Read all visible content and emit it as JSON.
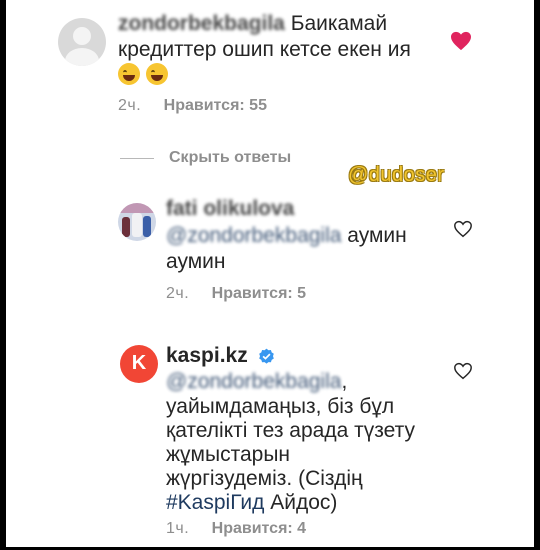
{
  "comment1": {
    "username": "zondorbekbagila",
    "text_line1": "Баикамай",
    "text_line2": "кредиттер ошип кетсе екен ия",
    "emojis": [
      "😂",
      "😂"
    ],
    "time": "2ч.",
    "likes": "Нравится: 55",
    "liked": true,
    "heart_color": "#e0245e"
  },
  "hide_replies": "Скрыть ответы",
  "watermark": "@dudoser",
  "reply1": {
    "username": "fati olikulova",
    "mention": "@zondorbekbagila",
    "text_line1": "аумин",
    "text_line2": "аумин",
    "time": "2ч.",
    "likes": "Нравится: 5"
  },
  "reply2": {
    "username": "kaspi.kz",
    "verified": true,
    "avatar_letter": "K",
    "mention": "@zondorbekbagila",
    "mention_suffix": ",",
    "lines": [
      "уайымдамаңыз, біз бұл",
      "қателікті тез арада түзету",
      "жұмыстарын",
      "жүргізудеміз. (Сіздің"
    ],
    "hashtag": "#KaspiГид",
    "signoff": "Айдос)",
    "time": "1ч.",
    "likes": "Нравится: 4",
    "brand_color": "#f14635"
  }
}
